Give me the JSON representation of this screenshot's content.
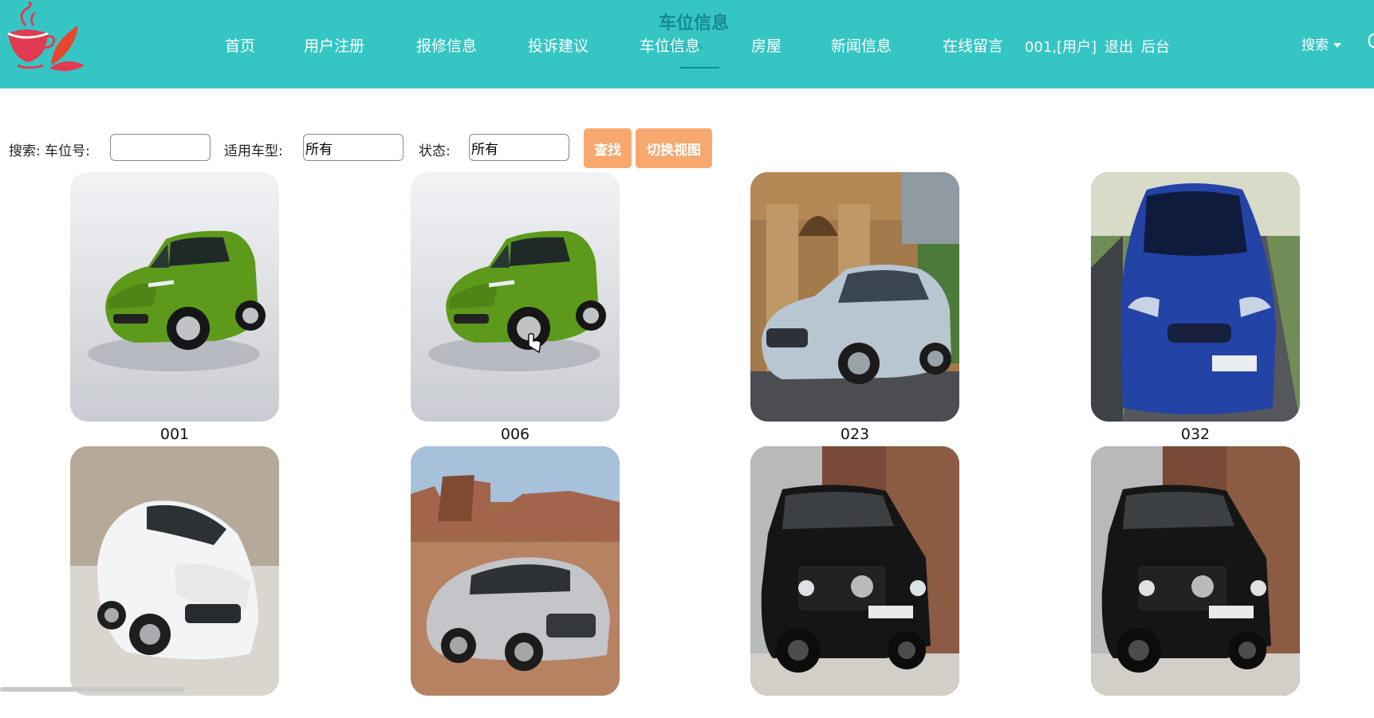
{
  "header": {
    "page_heading": "车位信息",
    "page_sub": "Details",
    "nav": [
      {
        "label": "首页"
      },
      {
        "label": "用户注册"
      },
      {
        "label": "报修信息"
      },
      {
        "label": "投诉建议"
      },
      {
        "label": "车位信息"
      },
      {
        "label": "房屋"
      },
      {
        "label": "新闻信息"
      },
      {
        "label": "在线留言"
      },
      {
        "label": "001,[用户]"
      },
      {
        "label": "退出"
      },
      {
        "label": "后台"
      }
    ],
    "search_menu": "搜索",
    "colors": {
      "bar": "#35c6c4",
      "heading": "#178a92"
    }
  },
  "search": {
    "spot_label": "搜索: 车位号:",
    "spot_value": "",
    "type_label": "适用车型:",
    "type_value": "所有",
    "status_label": "状态:",
    "status_value": "所有",
    "find_button": "查找",
    "switch_button": "切换视图",
    "button_color": "#f7a86f"
  },
  "cards": [
    {
      "label": "001",
      "image": "green-minivan"
    },
    {
      "label": "006",
      "image": "green-minivan"
    },
    {
      "label": "023",
      "image": "silver-sedan"
    },
    {
      "label": "032",
      "image": "blue-hatchback"
    },
    {
      "label": "",
      "image": "white-suv"
    },
    {
      "label": "",
      "image": "silver-suv-desert"
    },
    {
      "label": "",
      "image": "black-g-wagon"
    },
    {
      "label": "",
      "image": "black-g-wagon"
    }
  ]
}
